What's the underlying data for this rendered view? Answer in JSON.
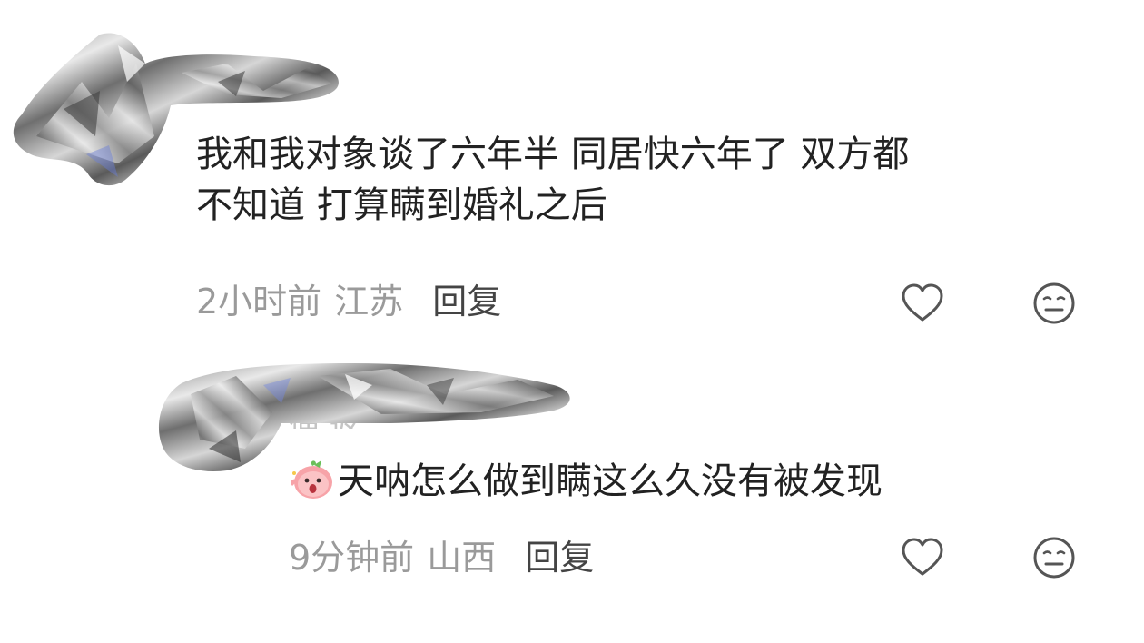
{
  "comments": [
    {
      "text_lines": [
        "我和我对象谈了六年半 同居快六年了 双方都",
        "不知道 打算瞒到婚礼之后"
      ],
      "time": "2小时前",
      "region": "江苏",
      "reply_label": "回复"
    },
    {
      "username_partial": "便     返",
      "sticker_icon": "shocked-peach-sticker-icon",
      "text": "天呐怎么做到瞒这么久没有被发现",
      "time": "9分钟前",
      "region": "山西",
      "reply_label": "回复"
    }
  ],
  "icons": {
    "like": "heart-outline-icon",
    "dislike": "meh-face-icon"
  },
  "colors": {
    "text": "#222222",
    "meta": "#9a9a9a",
    "reply": "#444444",
    "icon": "#555555"
  }
}
